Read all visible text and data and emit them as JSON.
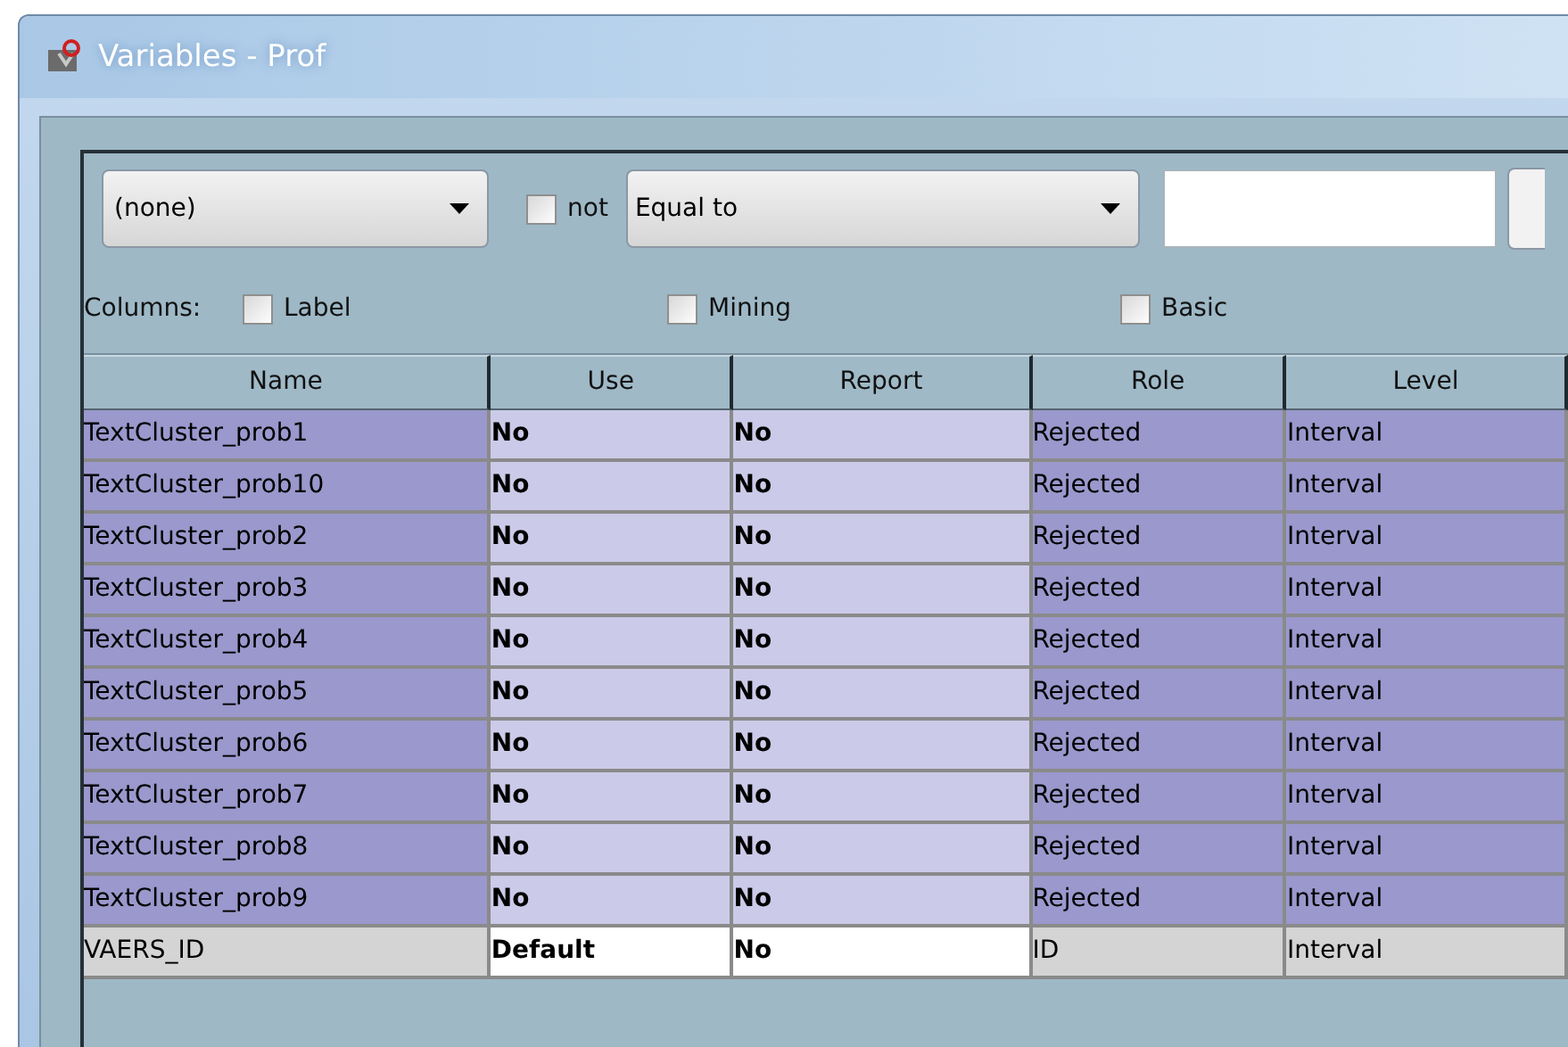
{
  "window": {
    "title": "Variables - Prof"
  },
  "filter": {
    "column_combo": "(none)",
    "not_checkbox": {
      "label": "not",
      "checked": false
    },
    "operator_combo": "Equal to"
  },
  "columns_options": {
    "label": "Columns:",
    "checkboxes": [
      {
        "label": "Label",
        "checked": false
      },
      {
        "label": "Mining",
        "checked": false
      },
      {
        "label": "Basic",
        "checked": false
      }
    ]
  },
  "table": {
    "columns": [
      "Name",
      "Use",
      "Report",
      "Role",
      "Level"
    ],
    "rows": [
      {
        "name": "TextCluster_prob1",
        "use": "No",
        "report": "No",
        "role": "Rejected",
        "level": "Interval",
        "selected": true
      },
      {
        "name": "TextCluster_prob10",
        "use": "No",
        "report": "No",
        "role": "Rejected",
        "level": "Interval",
        "selected": true
      },
      {
        "name": "TextCluster_prob2",
        "use": "No",
        "report": "No",
        "role": "Rejected",
        "level": "Interval",
        "selected": true
      },
      {
        "name": "TextCluster_prob3",
        "use": "No",
        "report": "No",
        "role": "Rejected",
        "level": "Interval",
        "selected": true
      },
      {
        "name": "TextCluster_prob4",
        "use": "No",
        "report": "No",
        "role": "Rejected",
        "level": "Interval",
        "selected": true
      },
      {
        "name": "TextCluster_prob5",
        "use": "No",
        "report": "No",
        "role": "Rejected",
        "level": "Interval",
        "selected": true
      },
      {
        "name": "TextCluster_prob6",
        "use": "No",
        "report": "No",
        "role": "Rejected",
        "level": "Interval",
        "selected": true
      },
      {
        "name": "TextCluster_prob7",
        "use": "No",
        "report": "No",
        "role": "Rejected",
        "level": "Interval",
        "selected": true
      },
      {
        "name": "TextCluster_prob8",
        "use": "No",
        "report": "No",
        "role": "Rejected",
        "level": "Interval",
        "selected": true
      },
      {
        "name": "TextCluster_prob9",
        "use": "No",
        "report": "No",
        "role": "Rejected",
        "level": "Interval",
        "selected": true
      },
      {
        "name": "VAERS_ID",
        "use": "Default",
        "report": "No",
        "role": "ID",
        "level": "Interval",
        "selected": false
      }
    ]
  }
}
